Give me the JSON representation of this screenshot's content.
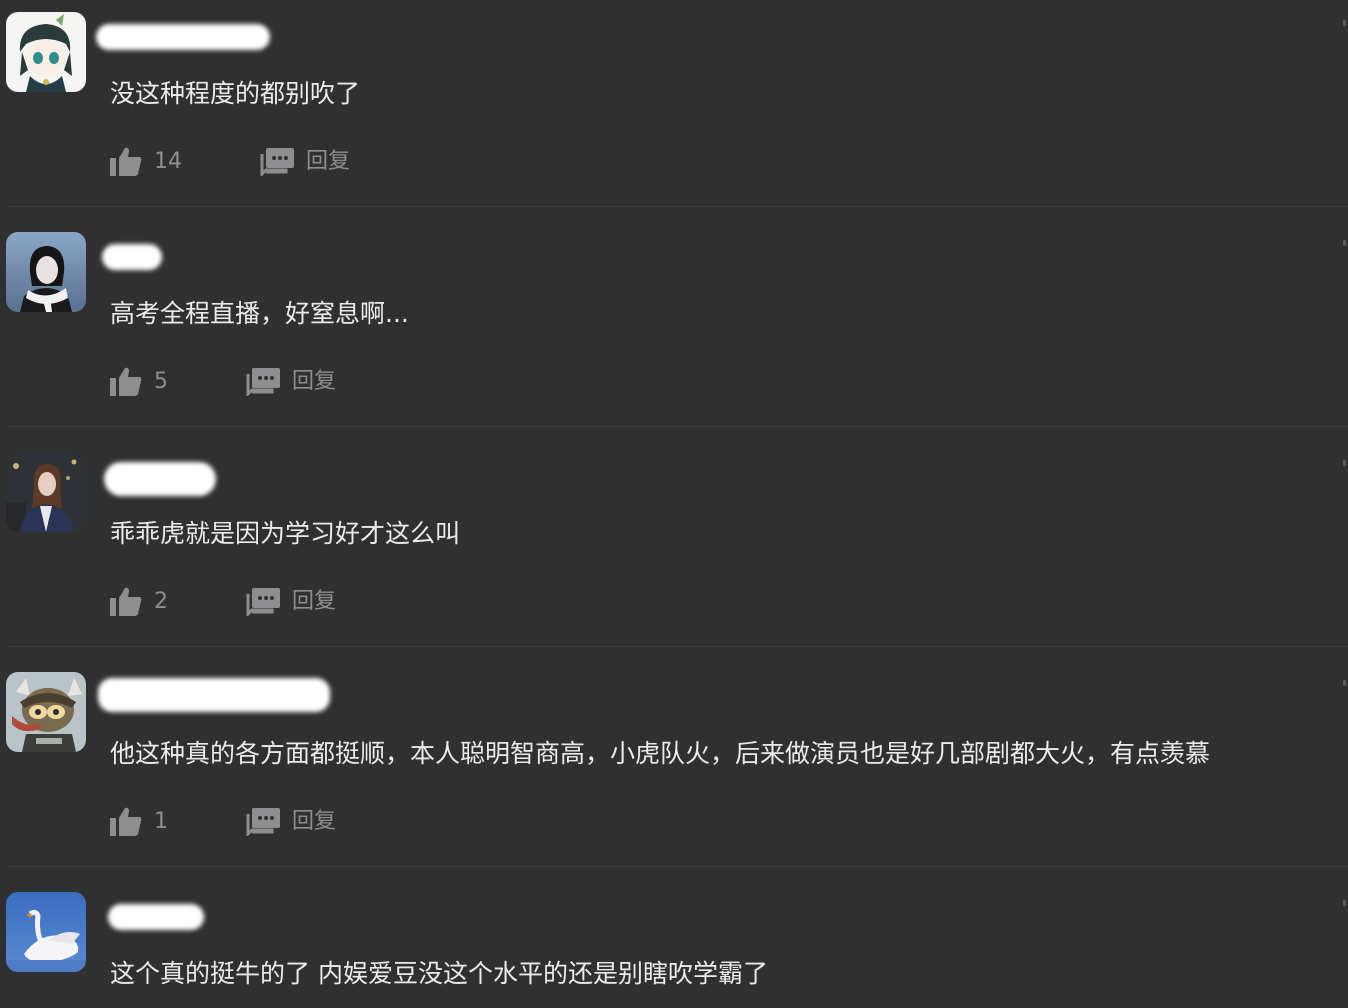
{
  "comments": [
    {
      "text": "没这种程度的都别吹了",
      "likes": "14",
      "reply_label": "回复",
      "avatar": "anime-boy-avatar"
    },
    {
      "text": "高考全程直播，好窒息啊...",
      "likes": "5",
      "reply_label": "回复",
      "avatar": "girl-scarf-avatar"
    },
    {
      "text": "乖乖虎就是因为学习好才这么叫",
      "likes": "2",
      "reply_label": "回复",
      "avatar": "girl-photo-avatar"
    },
    {
      "text": "他这种真的各方面都挺顺，本人聪明智商高，小虎队火，后来做演员也是好几部剧都大火，有点羡慕",
      "likes": "1",
      "reply_label": "回复",
      "avatar": "cartoon-character-avatar"
    },
    {
      "text": "这个真的挺牛的了 内娱爱豆没这个水平的还是别瞎吹学霸了",
      "avatar": "swan-avatar"
    }
  ],
  "colors": {
    "background": "#303031",
    "text": "#ebebeb",
    "muted": "#8e8e90"
  },
  "icons": {
    "like": "thumbs-up-icon",
    "reply": "reply-bubble-icon"
  }
}
